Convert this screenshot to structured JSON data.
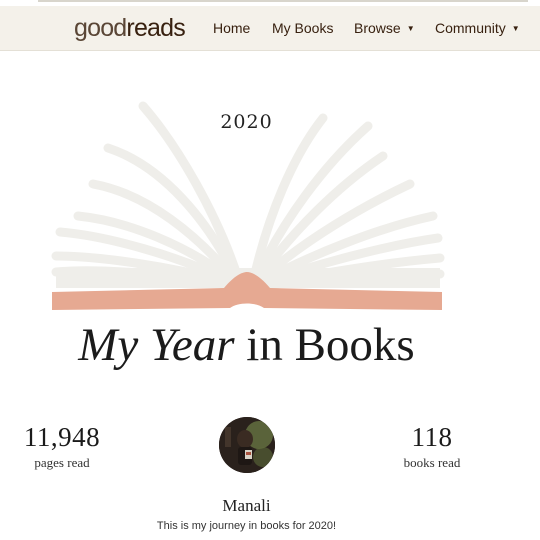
{
  "nav": {
    "logo_light": "good",
    "logo_bold": "reads",
    "items": [
      {
        "label": "Home",
        "dropdown": false
      },
      {
        "label": "My Books",
        "dropdown": false
      },
      {
        "label": "Browse",
        "dropdown": true
      },
      {
        "label": "Community",
        "dropdown": true
      }
    ],
    "caret": "▼"
  },
  "hero": {
    "year": "2020",
    "title_italic": "My Year",
    "title_rest": " in Books",
    "spine_color": "#e6a992",
    "page_color": "#efeeea"
  },
  "stats": {
    "pages_value": "11,948",
    "pages_label": "pages read",
    "books_value": "118",
    "books_label": "books read"
  },
  "profile": {
    "name": "Manali",
    "tagline": "This is my journey in books for 2020!",
    "avatar_icon": "profile-photo"
  }
}
